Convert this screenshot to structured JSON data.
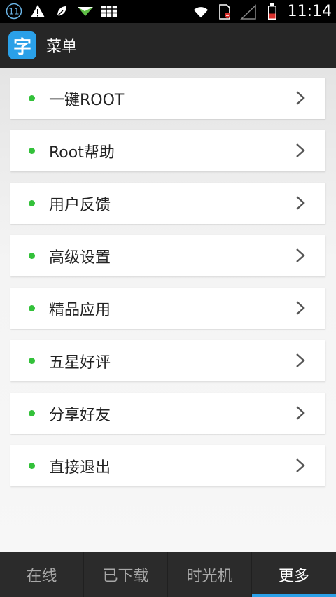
{
  "status_bar": {
    "notification_count": "11",
    "time": "11:14"
  },
  "header": {
    "logo_char": "字",
    "title": "菜单"
  },
  "menu": {
    "items": [
      {
        "label": "一键ROOT"
      },
      {
        "label": "Root帮助"
      },
      {
        "label": "用户反馈"
      },
      {
        "label": "高级设置"
      },
      {
        "label": "精品应用"
      },
      {
        "label": "五星好评"
      },
      {
        "label": "分享好友"
      },
      {
        "label": "直接退出"
      }
    ]
  },
  "tabs": [
    {
      "label": "在线"
    },
    {
      "label": "已下载"
    },
    {
      "label": "时光机"
    },
    {
      "label": "更多",
      "active": true
    }
  ],
  "colors": {
    "accent": "#2aa0e8",
    "bullet": "#33c13a"
  }
}
